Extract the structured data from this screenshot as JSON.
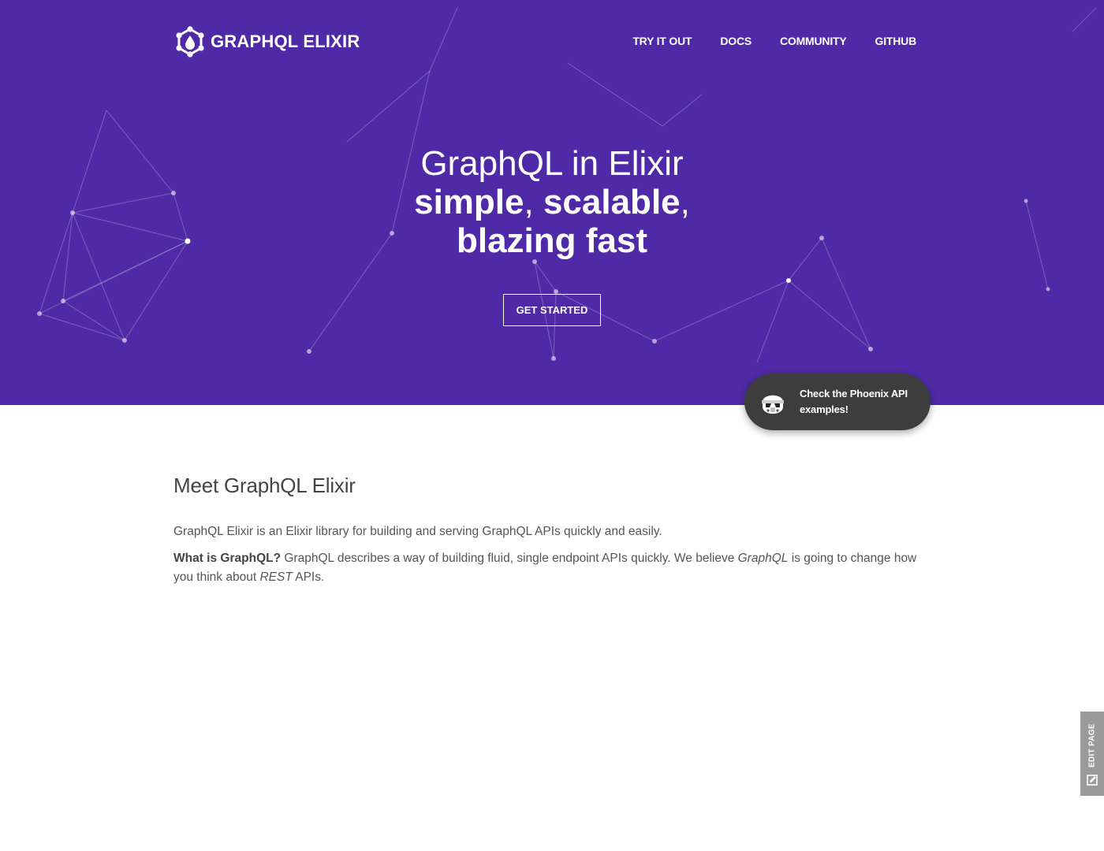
{
  "header": {
    "logo_text": "GRAPHQL ELIXIR",
    "nav": [
      "TRY IT OUT",
      "DOCS",
      "COMMUNITY",
      "GITHUB"
    ]
  },
  "hero": {
    "line1": "GraphQL in Elixir",
    "word_simple": "simple",
    "comma1": ", ",
    "word_scalable": "scalable",
    "comma2": ",",
    "line3": "blazing fast",
    "cta_label": "GET STARTED",
    "background_color": "#4f2aa6"
  },
  "promo": {
    "icon": "stormtrooper-icon",
    "text": "Check the Phoenix API examples!"
  },
  "intro": {
    "title": "Meet GraphQL Elixir",
    "paragraph1": "GraphQL Elixir is an Elixir library for building and serving GraphQL APIs quickly and easily.",
    "p2_bold": "What is GraphQL?",
    "p2_a": " GraphQL describes a way of building fluid, single endpoint APIs quickly. We believe ",
    "p2_em1": "GraphQL",
    "p2_b": " is going to change how you think about ",
    "p2_em2": "REST",
    "p2_c": " APIs."
  },
  "edit_tab": {
    "label": "EDIT PAGE",
    "icon": "edit-icon"
  }
}
